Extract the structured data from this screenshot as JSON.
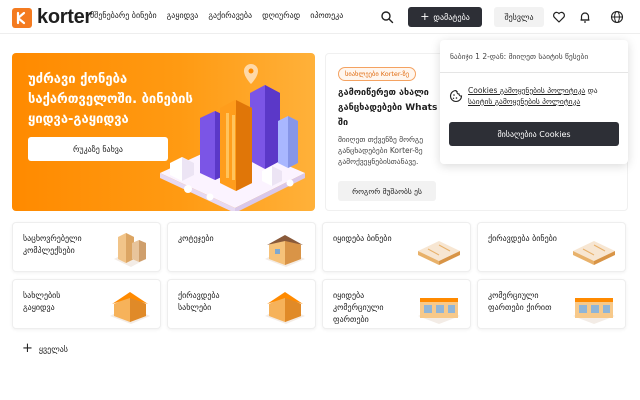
{
  "header": {
    "logo_text": "korter",
    "nav": [
      "მშენებარე ბინები",
      "გაყიდვა",
      "გაქირავება",
      "დღიურად",
      "იპოთეკა"
    ],
    "add_button": "დამატება",
    "login_button": "შესვლა",
    "icons": [
      "search-icon",
      "heart-icon",
      "bell-icon",
      "globe-icon"
    ]
  },
  "hero": {
    "title": "უძრავი ქონება\nსაქართველოში. ბინების\nყიდვა-გაყიდვა",
    "button": "რუკაზე ნახვა"
  },
  "promo": {
    "badge": "სიახლეები Korter-ზე",
    "title": "გამოიწერეთ ახალი\nგანცხადებები Whats\nში",
    "text": "მიიღეთ თქვენზე მორგე\nგანცხადებები Korter-ზე\nგამოქვეყნებისთანავე.",
    "button": "როგორ მუშაობს ეს"
  },
  "cookie": {
    "language_text": "ნაბიჯი 1 2-დან: მიიღეთ საიტის წესები",
    "policy_text_link1": "Cookies გამოყენების პოლიტიკა",
    "policy_text_and": " და ",
    "policy_text_link2": "საიტის გამოყენების პოლიტიკა",
    "accept_button": "მისაღებია Cookies"
  },
  "categories": [
    {
      "label": "საცხოვრებელი\nკომპლექსები"
    },
    {
      "label": "კოტეჯები"
    },
    {
      "label": "იყიდება ბინები"
    },
    {
      "label": "ქირავდება ბინები"
    },
    {
      "label": "სახლების\nგაყიდვა"
    },
    {
      "label": "ქირავდება\nსახლები"
    },
    {
      "label": "იყიდება\nკომერციული\nფართები"
    },
    {
      "label": "კომერციული\nფართები ქირით"
    }
  ],
  "all_link": "ყველას",
  "colors": {
    "accent": "#f47b20",
    "dark_button": "#2d2f36",
    "hero_gradient_start": "#ff8a00",
    "hero_gradient_end": "#ffb13a"
  }
}
